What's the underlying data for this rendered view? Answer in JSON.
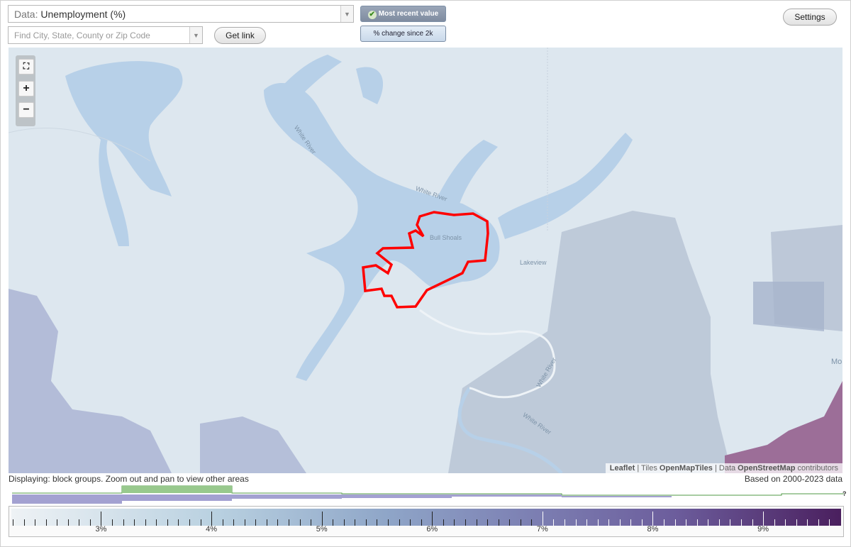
{
  "data_select": {
    "prefix": "Data:",
    "value": "Unemployment (%)"
  },
  "search": {
    "placeholder": "Find City, State, County or Zip Code"
  },
  "buttons": {
    "get_link": "Get link",
    "settings": "Settings"
  },
  "toggles": {
    "most_recent": "Most recent value",
    "pct_change": "% change since 2k"
  },
  "zoom": {
    "fit": "fit-bounds-icon",
    "plus": "+",
    "minus": "−"
  },
  "map_labels": {
    "bull_shoals": "Bull Shoals",
    "lakeview": "Lakeview",
    "white_river_1": "White River",
    "white_river_2": "White River",
    "white_river_3": "White River",
    "white_river_4": "White River",
    "mo": "Mo"
  },
  "attribution": {
    "leaflet": "Leaflet",
    "sep1": " | Tiles ",
    "tiles": "OpenMapTiles",
    "sep2": " | Data ",
    "data": "OpenStreetMap",
    "contrib": " contributors"
  },
  "status": {
    "displaying": "Displaying: block groups. Zoom out and pan to view other areas",
    "based_on": "Based on 2000-2023 data"
  },
  "histogram": {
    "help": "?"
  },
  "legend": {
    "labels": [
      "3%",
      "4%",
      "5%",
      "6%",
      "7%",
      "8%",
      "9%"
    ]
  },
  "colors": {
    "water": "#b7d0e8",
    "outline": "#ff0000",
    "high": "#9c6e98",
    "accent_green": "#98c98d",
    "accent_purple": "#a3a1d1"
  }
}
